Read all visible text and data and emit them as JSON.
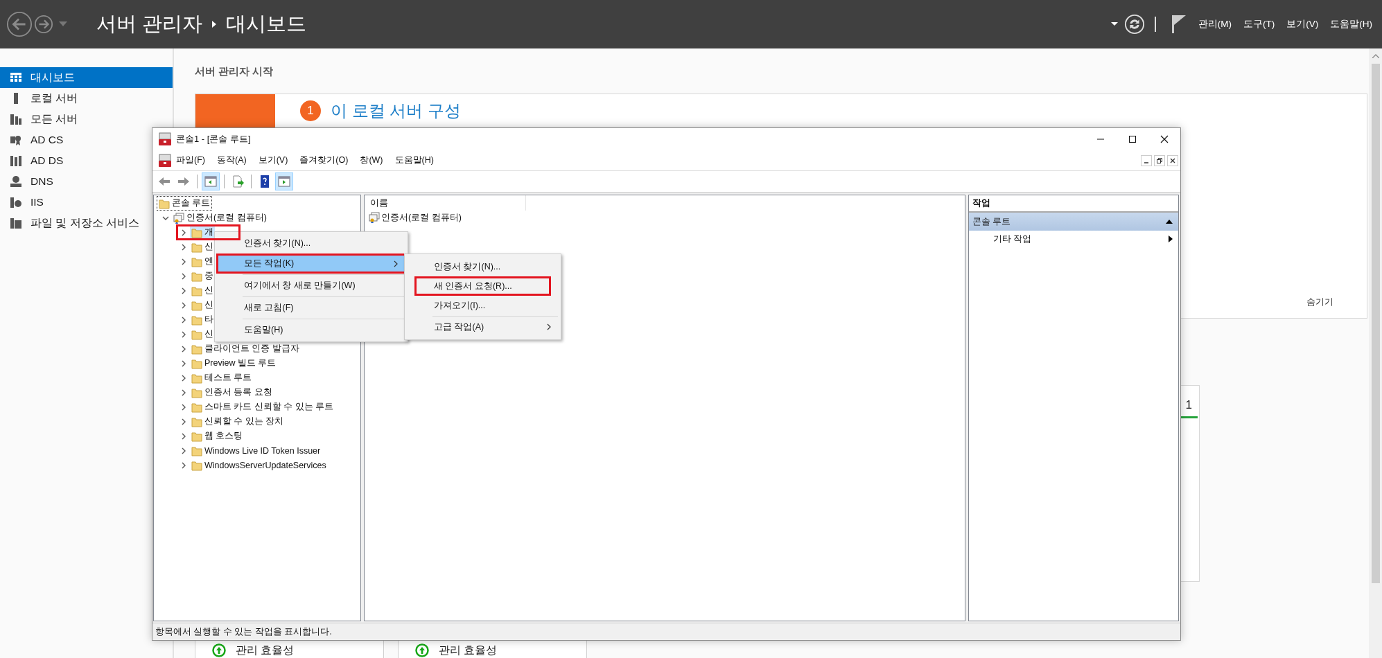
{
  "app_bar": {
    "parent": "서버 관리자",
    "page": "대시보드",
    "menus": [
      "관리(M)",
      "도구(T)",
      "보기(V)",
      "도움말(H)"
    ]
  },
  "sidebar": {
    "items": [
      {
        "label": "대시보드",
        "kind": "dashboard",
        "selected": true
      },
      {
        "label": "로컬 서버",
        "kind": "server",
        "selected": false
      },
      {
        "label": "모든 서버",
        "kind": "servers",
        "selected": false
      },
      {
        "label": "AD CS",
        "kind": "adcs",
        "selected": false
      },
      {
        "label": "AD DS",
        "kind": "adds",
        "selected": false
      },
      {
        "label": "DNS",
        "kind": "dns",
        "selected": false
      },
      {
        "label": "IIS",
        "kind": "iis",
        "selected": false
      },
      {
        "label": "파일 및 저장소 서비스",
        "kind": "files",
        "selected": false
      }
    ]
  },
  "dashboard": {
    "heading": "서버 관리자 시작",
    "welcome": {
      "step": "1",
      "title": "이 로컬 서버 구성",
      "hide": "숨기기"
    },
    "tile_count": "1",
    "tiles": [
      {
        "label": "관리 효율성"
      },
      {
        "label": "관리 효율성"
      }
    ]
  },
  "mmc": {
    "title": "콘솔1 - [콘솔 루트]",
    "menus": [
      "파일(F)",
      "동작(A)",
      "보기(V)",
      "즐겨찾기(O)",
      "창(W)",
      "도움말(H)"
    ],
    "toolbar": [
      {
        "kind": "back",
        "pressed": false
      },
      {
        "kind": "forward",
        "pressed": false
      },
      {
        "kind": "separator"
      },
      {
        "kind": "tree",
        "pressed": true
      },
      {
        "kind": "separator"
      },
      {
        "kind": "export",
        "pressed": false
      },
      {
        "kind": "separator"
      },
      {
        "kind": "help",
        "pressed": false
      },
      {
        "kind": "action_pane",
        "pressed": true
      }
    ],
    "tree": [
      {
        "label": "콘솔 루트",
        "focused": true,
        "selected": false,
        "children": [
          {
            "label": "인증서(로컬 컴퓨터)",
            "kind": "certificates",
            "expanded": true,
            "selected": false,
            "children": [
              {
                "label": "개",
                "expanded": false,
                "selected": true,
                "highlighted": true
              },
              {
                "label": "신",
                "expanded": false,
                "selected": false
              },
              {
                "label": "엔",
                "expanded": false,
                "selected": false
              },
              {
                "label": "중",
                "expanded": false,
                "selected": false
              },
              {
                "label": "신",
                "expanded": false,
                "selected": false
              },
              {
                "label": "신",
                "expanded": false,
                "selected": false
              },
              {
                "label": "타",
                "expanded": false,
                "selected": false
              },
              {
                "label": "신",
                "expanded": false,
                "selected": false
              },
              {
                "label": "클라이언트 인증 발급자",
                "expanded": false,
                "selected": false
              },
              {
                "label": "Preview 빌드 루트",
                "expanded": false,
                "selected": false
              },
              {
                "label": "테스트 루트",
                "expanded": false,
                "selected": false
              },
              {
                "label": "인증서 등록 요청",
                "expanded": false,
                "selected": false
              },
              {
                "label": "스마트 카드 신뢰할 수 있는 루트",
                "expanded": false,
                "selected": false
              },
              {
                "label": "신뢰할 수 있는 장치",
                "expanded": false,
                "selected": false
              },
              {
                "label": "웹 호스팅",
                "expanded": false,
                "selected": false
              },
              {
                "label": "Windows Live ID Token Issuer",
                "expanded": false,
                "selected": false
              },
              {
                "label": "WindowsServerUpdateServices",
                "expanded": false,
                "selected": false
              }
            ]
          }
        ]
      }
    ],
    "list": {
      "columns": [
        "이름"
      ],
      "rows": [
        "인증서(로컬 컴퓨터)"
      ]
    },
    "actions": {
      "title": "작업",
      "section": "콘솔 루트",
      "items": [
        "기타 작업"
      ]
    },
    "status": "항목에서 실행할 수 있는 작업을 표시합니다."
  },
  "context_menu": {
    "items": [
      {
        "label": "인증서 찾기(N)...",
        "selected": false,
        "submenu": false,
        "highlighted": false
      },
      {
        "label": "모든 작업(K)",
        "selected": true,
        "submenu": true,
        "highlighted": true
      },
      {
        "label": "여기에서 창 새로 만들기(W)",
        "selected": false,
        "submenu": false,
        "highlighted": false
      },
      {
        "label": "새로 고침(F)",
        "selected": false,
        "submenu": false,
        "highlighted": false
      },
      {
        "label": "도움말(H)",
        "selected": false,
        "submenu": false,
        "highlighted": false
      }
    ]
  },
  "submenu": {
    "items": [
      {
        "label": "인증서 찾기(N)...",
        "selected": false,
        "submenu": false,
        "highlighted": false
      },
      {
        "label": "새 인증서 요청(R)...",
        "selected": false,
        "submenu": false,
        "highlighted": true
      },
      {
        "label": "가져오기(I)...",
        "selected": false,
        "submenu": false,
        "highlighted": false
      },
      {
        "label": "고급 작업(A)",
        "selected": false,
        "submenu": true,
        "highlighted": false
      }
    ]
  }
}
